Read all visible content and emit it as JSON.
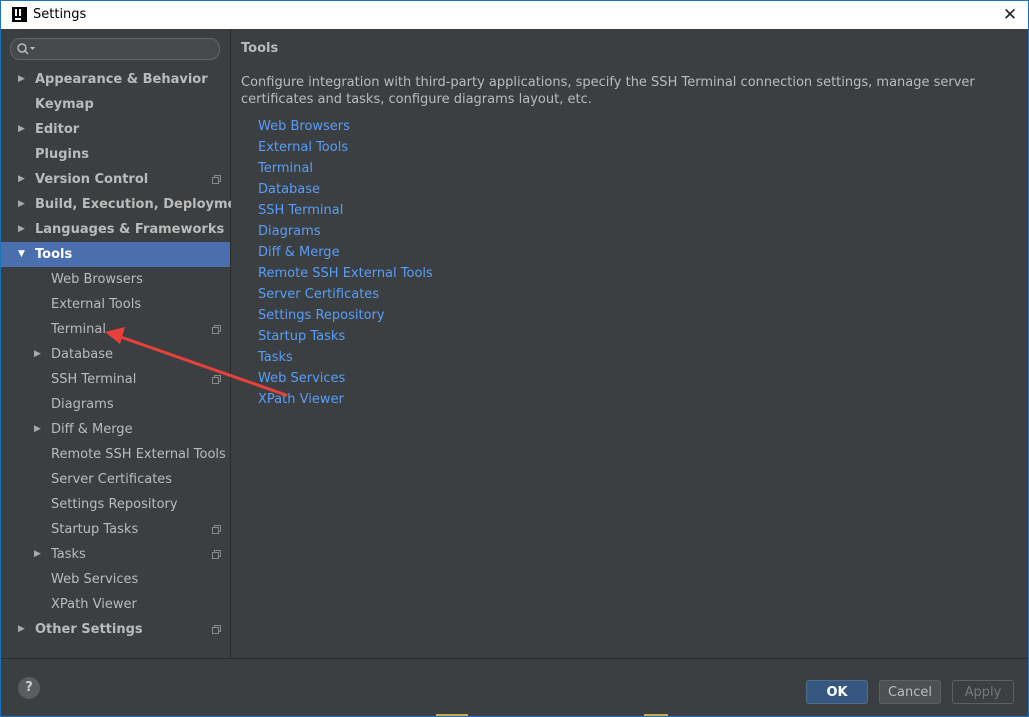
{
  "window": {
    "title": "Settings"
  },
  "search": {
    "placeholder": ""
  },
  "sidebar": {
    "items": [
      {
        "label": "Appearance & Behavior"
      },
      {
        "label": "Keymap"
      },
      {
        "label": "Editor"
      },
      {
        "label": "Plugins"
      },
      {
        "label": "Version Control"
      },
      {
        "label": "Build, Execution, Deployment"
      },
      {
        "label": "Languages & Frameworks"
      },
      {
        "label": "Tools"
      },
      {
        "label": "Web Browsers"
      },
      {
        "label": "External Tools"
      },
      {
        "label": "Terminal"
      },
      {
        "label": "Database"
      },
      {
        "label": "SSH Terminal"
      },
      {
        "label": "Diagrams"
      },
      {
        "label": "Diff & Merge"
      },
      {
        "label": "Remote SSH External Tools"
      },
      {
        "label": "Server Certificates"
      },
      {
        "label": "Settings Repository"
      },
      {
        "label": "Startup Tasks"
      },
      {
        "label": "Tasks"
      },
      {
        "label": "Web Services"
      },
      {
        "label": "XPath Viewer"
      },
      {
        "label": "Other Settings"
      }
    ]
  },
  "content": {
    "title": "Tools",
    "description": "Configure integration with third-party applications, specify the SSH Terminal connection settings, manage server certificates and tasks, configure diagrams layout, etc.",
    "links": [
      "Web Browsers",
      "External Tools",
      "Terminal",
      "Database",
      "SSH Terminal",
      "Diagrams",
      "Diff & Merge",
      "Remote SSH External Tools",
      "Server Certificates",
      "Settings Repository",
      "Startup Tasks",
      "Tasks",
      "Web Services",
      "XPath Viewer"
    ]
  },
  "footer": {
    "help": "?",
    "ok": "OK",
    "cancel": "Cancel",
    "apply": "Apply"
  },
  "icons": {
    "app": "intellij-icon",
    "close": "close-icon",
    "search": "search-icon",
    "project_level": "project-settings-icon",
    "annotation": "red-arrow"
  },
  "colors": {
    "selection": "#4b6eaf",
    "link": "#589df6",
    "annotation_arrow": "#e8413b"
  }
}
